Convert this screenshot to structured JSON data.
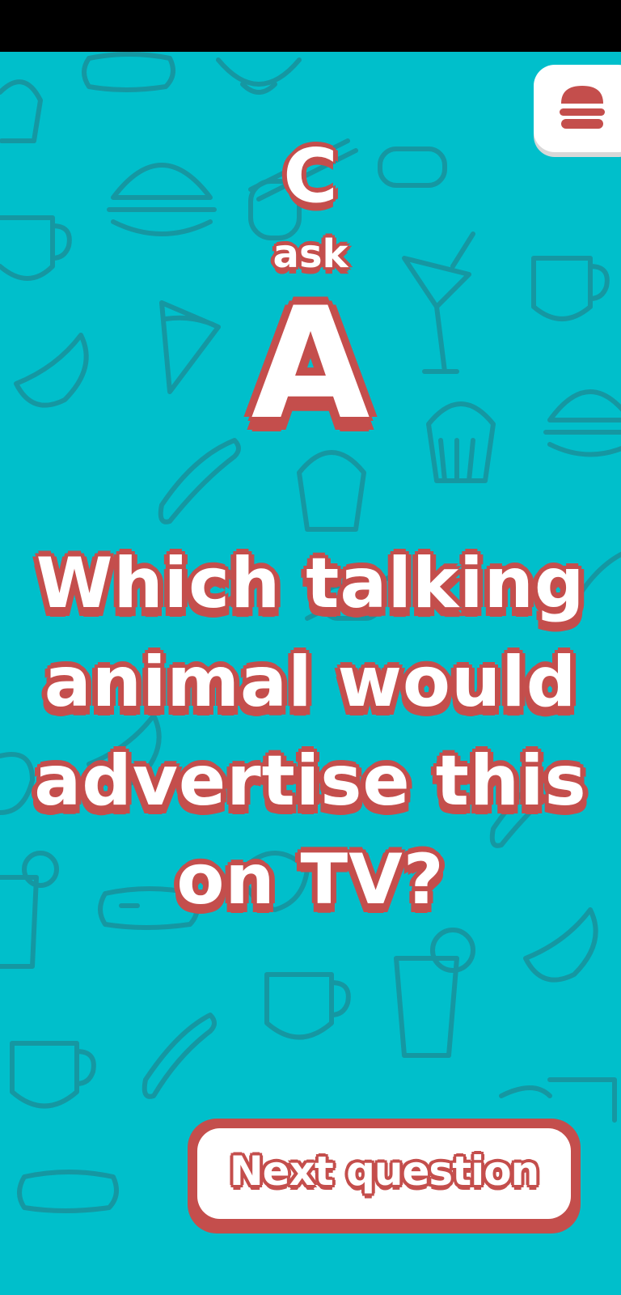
{
  "title": {
    "top_letter": "C",
    "connector": "ask",
    "bottom_letter": "A"
  },
  "question": {
    "text": "Which talking animal would advertise this on TV?"
  },
  "buttons": {
    "next_label": "Next question"
  },
  "icons": {
    "menu": "burger-menu-icon",
    "background": "food-pattern"
  },
  "colors": {
    "background": "#00bfcb",
    "pattern": "#1597a2",
    "accent": "#c44e4c",
    "text": "#ffffff"
  }
}
